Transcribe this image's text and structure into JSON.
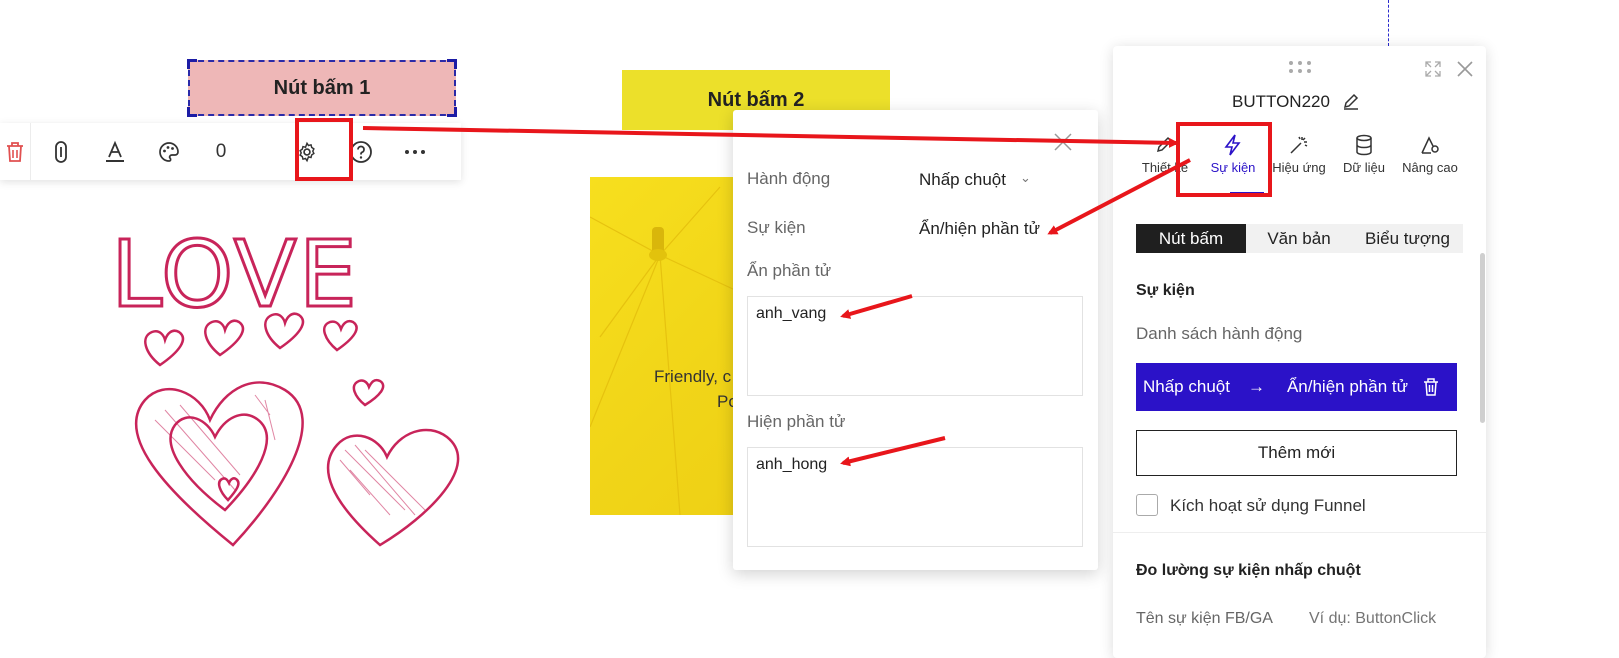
{
  "canvas": {
    "button1_label": "Nút bấm 1",
    "button2_label": "Nút bấm 2",
    "toolbar": {
      "counter": "0"
    },
    "yellow_image": {
      "line1": "Friendly, c",
      "line2": "Po"
    },
    "love_text": "LOVE"
  },
  "popup": {
    "action_label": "Hành động",
    "action_value": "Nhấp chuột",
    "event_label": "Sự kiện",
    "event_value": "Ẩn/hiện phần tử",
    "hide_label": "Ẩn phần tử",
    "hide_value": "anh_vang",
    "show_label": "Hiện phần tử",
    "show_value": "anh_hong"
  },
  "panel": {
    "title": "BUTTON220",
    "tabs": [
      {
        "label": "Thiết kế",
        "icon": "pencil-icon"
      },
      {
        "label": "Sự kiện",
        "icon": "lightning-icon"
      },
      {
        "label": "Hiệu ứng",
        "icon": "magic-wand-icon"
      },
      {
        "label": "Dữ liệu",
        "icon": "database-icon"
      },
      {
        "label": "Nâng cao",
        "icon": "advanced-icon"
      }
    ],
    "segments": [
      "Nút bấm",
      "Văn bản",
      "Biểu tượng"
    ],
    "section_title": "Sự kiện",
    "action_list_label": "Danh sách hành động",
    "action_item": {
      "trigger": "Nhấp chuột",
      "arrow": "→",
      "action": "Ẩn/hiện phần tử"
    },
    "add_button": "Thêm mới",
    "funnel_label": "Kích hoạt sử dụng Funnel",
    "measure_title": "Đo lường sự kiện nhấp chuột",
    "event_name_label": "Tên sự kiện FB/GA",
    "event_name_placeholder": "Ví dụ: ButtonClick"
  },
  "colors": {
    "accent": "#2b12c8",
    "annotation_red": "#e8161b",
    "button1_bg": "#eeb7b7",
    "button2_bg": "#ece02a",
    "love_pink": "#c8245a"
  }
}
